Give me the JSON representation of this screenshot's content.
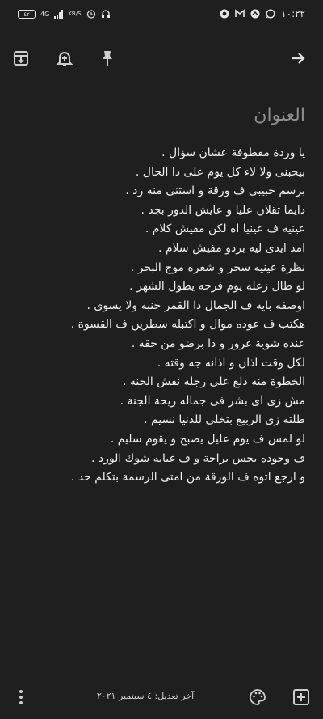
{
  "status_bar": {
    "battery": "٤٢",
    "network": "4G",
    "speed_unit": "KB/S",
    "time": "١٠:٢٢"
  },
  "icons": {
    "archive": "archive-icon",
    "reminder": "add-alert-icon",
    "pin": "pin-icon",
    "forward": "arrow-forward-icon",
    "more": "more-vert-icon",
    "palette": "palette-icon",
    "add": "add-box-icon"
  },
  "note": {
    "title_placeholder": "العنوان",
    "lines": [
      "يا وردة مقطوفة عشان سؤال .",
      "بيحبنى ولا لاء كل يوم على دا الحال .",
      "برسم حبيبى ف ورقة و استنى منه رد .",
      "دايما تقلان عليا و عايش الدور بجد .",
      "عينيه ف عينيا اه لكن مفيش كلام .",
      "امد ايدى ليه بردو مفيش سلام .",
      "نظرة عينيه سحر و شعره موج البحر .",
      "لو طال زعله يوم  فرحه يطول الشهر .",
      "اوصفه بايه ف الجمال دا القمر جنبه ولا يسوى .",
      "هكتب ف عوده موال و اكتبله سطرين ف القسوة .",
      "عنده شوية غرور و دا برضو من حقه .",
      "لكل وقت اذان و اذانه جه وقته .",
      "الخطوة منه دلع على رجله نقش الحنه .",
      "مش زى اى بشر فى جماله ريحة الجنة .",
      "طلته زى الربيع بتخلى للدنيا نسيم .",
      "لو لمس ف يوم عليل يصبح و يقوم سليم .",
      "ف وجوده بحس براحة و ف غيابه شوك الورد .",
      "و ارجع اتوه ف الورقة من امتى الرسمة بتكلم حد ."
    ]
  },
  "footer": {
    "edited_text": "آخر تعديل: ٤ سبتمبر ٢٠٢١"
  }
}
